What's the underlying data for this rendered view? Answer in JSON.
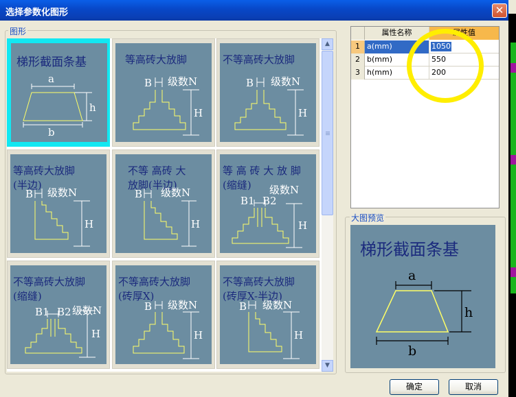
{
  "window": {
    "title": "选择参数化图形",
    "close_label": "✕"
  },
  "shapes_group": {
    "label": "图形"
  },
  "gallery": {
    "selected_index": 0,
    "items": [
      {
        "title": "梯形截面条基",
        "labels": [
          "a",
          "h",
          "b"
        ]
      },
      {
        "title": "等高砖大放脚",
        "labels": [
          "B",
          "级数N",
          "H"
        ]
      },
      {
        "title": "不等高砖大放脚",
        "labels": [
          "B",
          "级数N",
          "H"
        ]
      },
      {
        "title": "等高砖大放脚\n(半边)",
        "labels": [
          "B",
          "级数N",
          "H"
        ]
      },
      {
        "title": "不等 高砖 大\n放脚(半边)",
        "labels": [
          "B",
          "级数N",
          "H"
        ]
      },
      {
        "title": "等 高 砖 大 放 脚\n(缩缝)",
        "labels": [
          "B1",
          "B2",
          "级数N",
          "H"
        ]
      },
      {
        "title": "不等高砖大放脚\n(缩缝)",
        "labels": [
          "B1",
          "B2",
          "级数N",
          "H"
        ]
      },
      {
        "title": "不等高砖大放脚\n(砖厚X)",
        "labels": [
          "B",
          "级数N",
          "H"
        ]
      },
      {
        "title": "不等高砖大放脚\n(砖厚X-半边)",
        "labels": [
          "B",
          "级数N",
          "H"
        ]
      }
    ]
  },
  "property_grid": {
    "headers": [
      "属性名称",
      "属性值"
    ],
    "rows": [
      {
        "index": "1",
        "name": "a(mm)",
        "value": "1050"
      },
      {
        "index": "2",
        "name": "b(mm)",
        "value": "550"
      },
      {
        "index": "3",
        "name": "h(mm)",
        "value": "200"
      }
    ]
  },
  "preview": {
    "label": "大图预览",
    "title": "梯形截面条基",
    "labels": [
      "a",
      "h",
      "b"
    ]
  },
  "buttons": {
    "ok": "确定",
    "cancel": "取消"
  },
  "colors": {
    "panel": "#6c8da1",
    "selection": "#12e8f2",
    "highlight": "#ffee00",
    "title_text": "#1b2a7d"
  }
}
